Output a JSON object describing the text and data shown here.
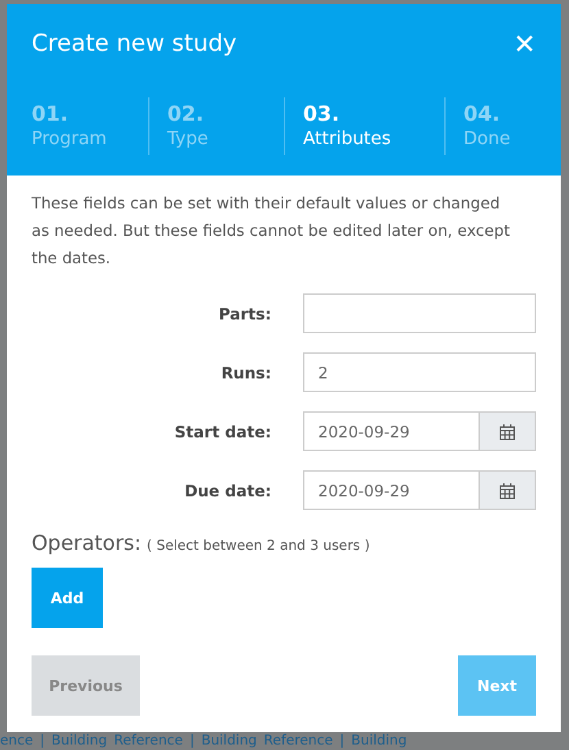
{
  "dialog": {
    "title": "Create new study",
    "close": "✕"
  },
  "steps": [
    {
      "number": "01.",
      "label": "Program",
      "selected": false
    },
    {
      "number": "02.",
      "label": "Type",
      "selected": false
    },
    {
      "number": "03.",
      "label": "Attributes",
      "selected": true
    },
    {
      "number": "04.",
      "label": "Done",
      "selected": false
    }
  ],
  "intro": "These fields can be set with their default values or changed as needed. But these fields cannot be edited later on, except the dates.",
  "fields": [
    {
      "label": "Parts:",
      "kind": "text"
    },
    {
      "label": "Runs:",
      "kind": "text",
      "value": "2"
    },
    {
      "label": "Start date:",
      "kind": "date",
      "value": "2020-09-29"
    },
    {
      "label": "Due date:",
      "kind": "date",
      "value": "2020-09-29"
    }
  ],
  "operators": {
    "label": "Operators:",
    "hint": "( Select between 2 and 3 users )",
    "button": "Add"
  },
  "buttons": [
    {
      "label": "Previous",
      "kind": "secondary",
      "disabled": false
    },
    {
      "label": "Next",
      "kind": "primary",
      "disabled": true
    }
  ],
  "background_links": [
    "ence",
    "|",
    "Building",
    "Reference",
    "|",
    "Building",
    "Reference",
    "|",
    "Building"
  ]
}
